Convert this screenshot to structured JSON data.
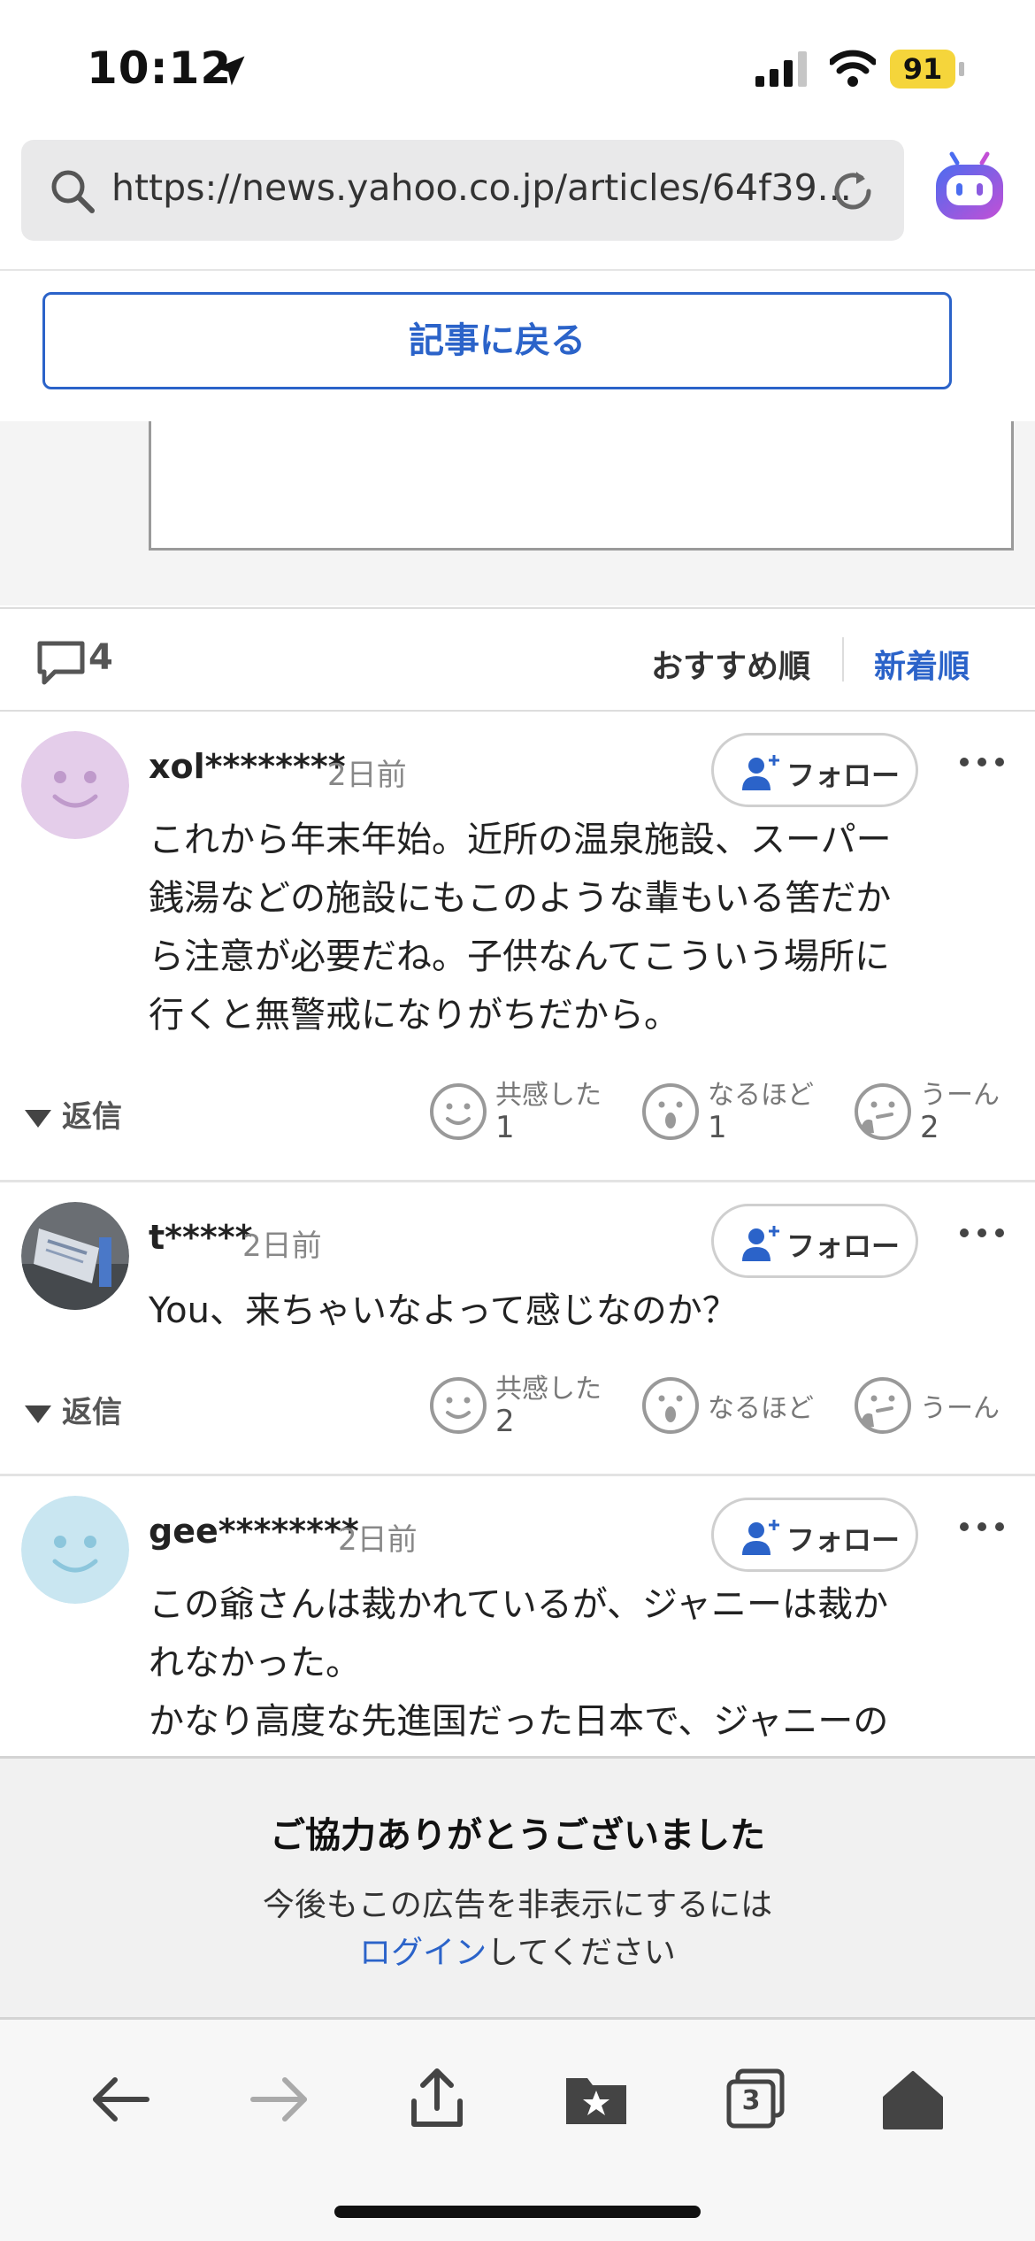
{
  "status_bar": {
    "time": "10:12",
    "battery": "91"
  },
  "browser": {
    "url": "https://news.yahoo.co.jp/articles/64f39..."
  },
  "back_button": "記事に戻る",
  "sort": {
    "comment_count": "4",
    "recommended": "おすすめ順",
    "newest": "新着順"
  },
  "comments": [
    {
      "user": "xol********",
      "ago": "2日前",
      "follow": "フォロー",
      "lines": [
        "これから年末年始。近所の温泉施設、スーパー",
        "銭湯などの施設にもこのような輩もいる筈だか",
        "ら注意が必要だね。子供なんてこういう場所に",
        "行くと無警戒になりがちだから。"
      ],
      "reply": "返信",
      "reactions": [
        {
          "label": "共感した",
          "count": "1"
        },
        {
          "label": "なるほど",
          "count": "1"
        },
        {
          "label": "うーん",
          "count": "2"
        }
      ]
    },
    {
      "user": "t*****",
      "ago": "2日前",
      "follow": "フォロー",
      "lines": [
        "You、来ちゃいなよって感じなのか？"
      ],
      "reply": "返信",
      "reactions": [
        {
          "label": "共感した",
          "count": "2"
        },
        {
          "label": "なるほど",
          "count": ""
        },
        {
          "label": "うーん",
          "count": ""
        }
      ]
    },
    {
      "user": "gee********",
      "ago": "2日前",
      "follow": "フォロー",
      "lines": [
        "この爺さんは裁かれているが、ジャニーは裁か",
        "れなかった。",
        "かなり高度な先進国だった日本で、ジャニーの"
      ]
    }
  ],
  "ad": {
    "title": "ご協力ありがとうございました",
    "line1": "今後もこの広告を非表示にするには",
    "login": "ログイン",
    "line2_suffix": "してください"
  },
  "toolbar": {
    "tabs_count": "3"
  },
  "colors": {
    "accent": "#2b63c9",
    "battery": "#f5d53b"
  }
}
